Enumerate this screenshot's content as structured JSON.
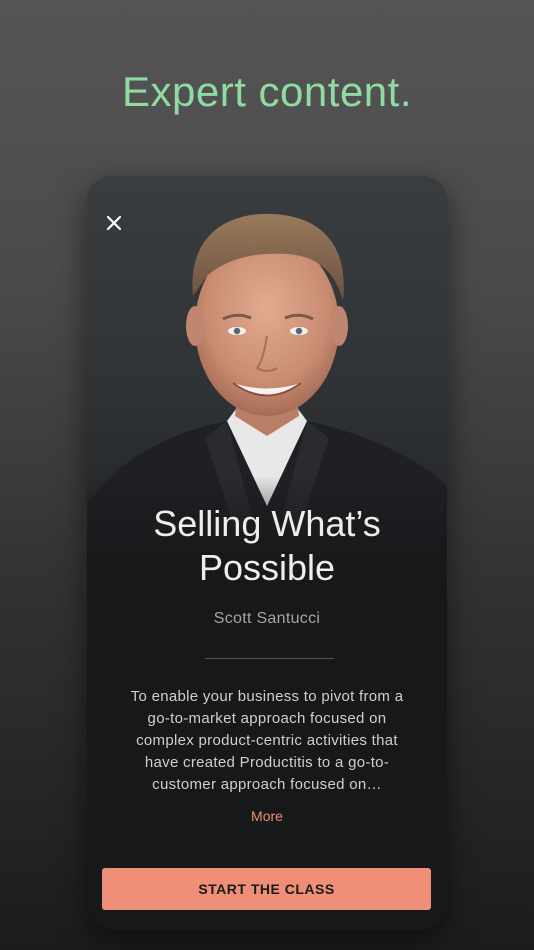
{
  "headline": "Expert content.",
  "card": {
    "close_icon": "close-icon",
    "title": "Selling What’s Possible",
    "author": "Scott Santucci",
    "description": "To enable your business to pivot from a go-to-market approach focused on complex product-centric activities that have created Productitis to a go-to-customer approach focused on…",
    "more_label": "More",
    "cta_label": "START THE CLASS"
  },
  "colors": {
    "accent_green": "#8fdca3",
    "accent_coral": "#f08f78",
    "card_bg": "#17181a"
  }
}
